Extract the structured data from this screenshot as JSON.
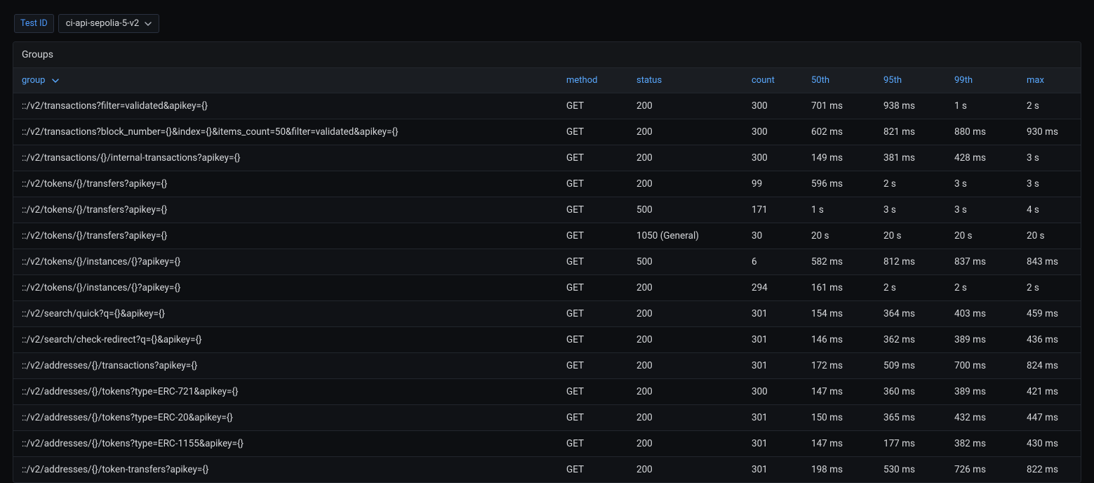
{
  "toolbar": {
    "filter_label": "Test ID",
    "filter_value": "ci-api-sepolia-5-v2"
  },
  "panel": {
    "title": "Groups"
  },
  "columns": {
    "group": "group",
    "method": "method",
    "status": "status",
    "count": "count",
    "p50": "50th",
    "p95": "95th",
    "p99": "99th",
    "max": "max"
  },
  "rows": [
    {
      "group": "::/v2/transactions?filter=validated&apikey={}",
      "method": "GET",
      "status": "200",
      "count": "300",
      "p50": "701 ms",
      "p95": "938 ms",
      "p99": "1 s",
      "max": "2 s"
    },
    {
      "group": "::/v2/transactions?block_number={}&index={}&items_count=50&filter=validated&apikey={}",
      "method": "GET",
      "status": "200",
      "count": "300",
      "p50": "602 ms",
      "p95": "821 ms",
      "p99": "880 ms",
      "max": "930 ms"
    },
    {
      "group": "::/v2/transactions/{}/internal-transactions?apikey={}",
      "method": "GET",
      "status": "200",
      "count": "300",
      "p50": "149 ms",
      "p95": "381 ms",
      "p99": "428 ms",
      "max": "3 s"
    },
    {
      "group": "::/v2/tokens/{}/transfers?apikey={}",
      "method": "GET",
      "status": "200",
      "count": "99",
      "p50": "596 ms",
      "p95": "2 s",
      "p99": "3 s",
      "max": "3 s"
    },
    {
      "group": "::/v2/tokens/{}/transfers?apikey={}",
      "method": "GET",
      "status": "500",
      "count": "171",
      "p50": "1 s",
      "p95": "3 s",
      "p99": "3 s",
      "max": "4 s"
    },
    {
      "group": "::/v2/tokens/{}/transfers?apikey={}",
      "method": "GET",
      "status": "1050 (General)",
      "count": "30",
      "p50": "20 s",
      "p95": "20 s",
      "p99": "20 s",
      "max": "20 s"
    },
    {
      "group": "::/v2/tokens/{}/instances/{}?apikey={}",
      "method": "GET",
      "status": "500",
      "count": "6",
      "p50": "582 ms",
      "p95": "812 ms",
      "p99": "837 ms",
      "max": "843 ms"
    },
    {
      "group": "::/v2/tokens/{}/instances/{}?apikey={}",
      "method": "GET",
      "status": "200",
      "count": "294",
      "p50": "161 ms",
      "p95": "2 s",
      "p99": "2 s",
      "max": "2 s"
    },
    {
      "group": "::/v2/search/quick?q={}&apikey={}",
      "method": "GET",
      "status": "200",
      "count": "301",
      "p50": "154 ms",
      "p95": "364 ms",
      "p99": "403 ms",
      "max": "459 ms"
    },
    {
      "group": "::/v2/search/check-redirect?q={}&apikey={}",
      "method": "GET",
      "status": "200",
      "count": "301",
      "p50": "146 ms",
      "p95": "362 ms",
      "p99": "389 ms",
      "max": "436 ms"
    },
    {
      "group": "::/v2/addresses/{}/transactions?apikey={}",
      "method": "GET",
      "status": "200",
      "count": "301",
      "p50": "172 ms",
      "p95": "509 ms",
      "p99": "700 ms",
      "max": "824 ms"
    },
    {
      "group": "::/v2/addresses/{}/tokens?type=ERC-721&apikey={}",
      "method": "GET",
      "status": "200",
      "count": "300",
      "p50": "147 ms",
      "p95": "360 ms",
      "p99": "389 ms",
      "max": "421 ms"
    },
    {
      "group": "::/v2/addresses/{}/tokens?type=ERC-20&apikey={}",
      "method": "GET",
      "status": "200",
      "count": "301",
      "p50": "150 ms",
      "p95": "365 ms",
      "p99": "432 ms",
      "max": "447 ms"
    },
    {
      "group": "::/v2/addresses/{}/tokens?type=ERC-1155&apikey={}",
      "method": "GET",
      "status": "200",
      "count": "301",
      "p50": "147 ms",
      "p95": "177 ms",
      "p99": "382 ms",
      "max": "430 ms"
    },
    {
      "group": "::/v2/addresses/{}/token-transfers?apikey={}",
      "method": "GET",
      "status": "200",
      "count": "301",
      "p50": "198 ms",
      "p95": "530 ms",
      "p99": "726 ms",
      "max": "822 ms"
    }
  ]
}
